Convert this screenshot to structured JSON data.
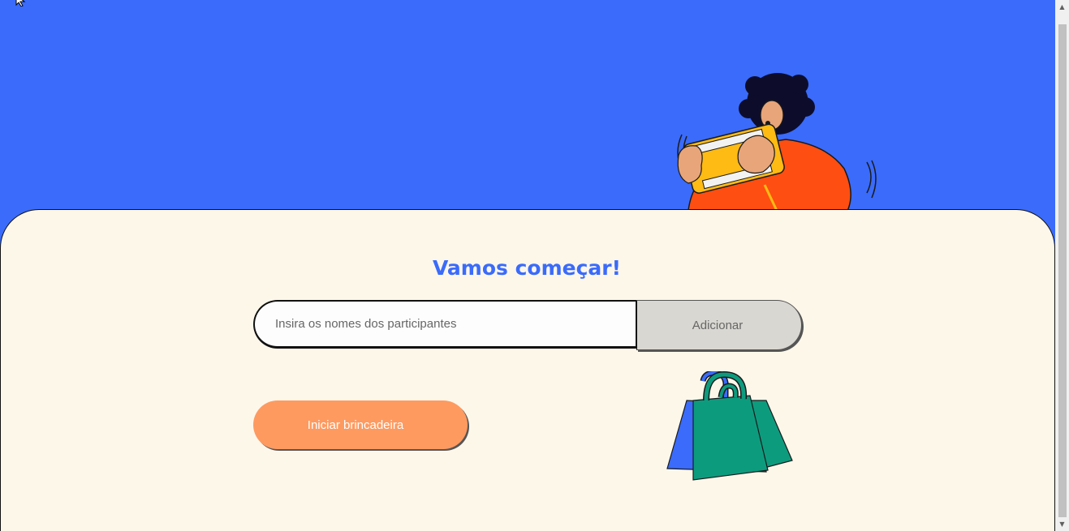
{
  "page": {
    "title": "Vamos começar!",
    "colors": {
      "background_blue": "#3a6bfb",
      "panel_cream": "#fdf7ea",
      "accent_orange": "#fe9a60",
      "button_gray": "#d9d7d1"
    }
  },
  "form": {
    "input_placeholder": "Insira os nomes dos participantes",
    "input_value": "",
    "add_label": "Adicionar"
  },
  "actions": {
    "start_label": "Iniciar brincadeira"
  },
  "illustrations": {
    "hero": "person-playing-handheld-console",
    "bags": "shopping-bags"
  }
}
